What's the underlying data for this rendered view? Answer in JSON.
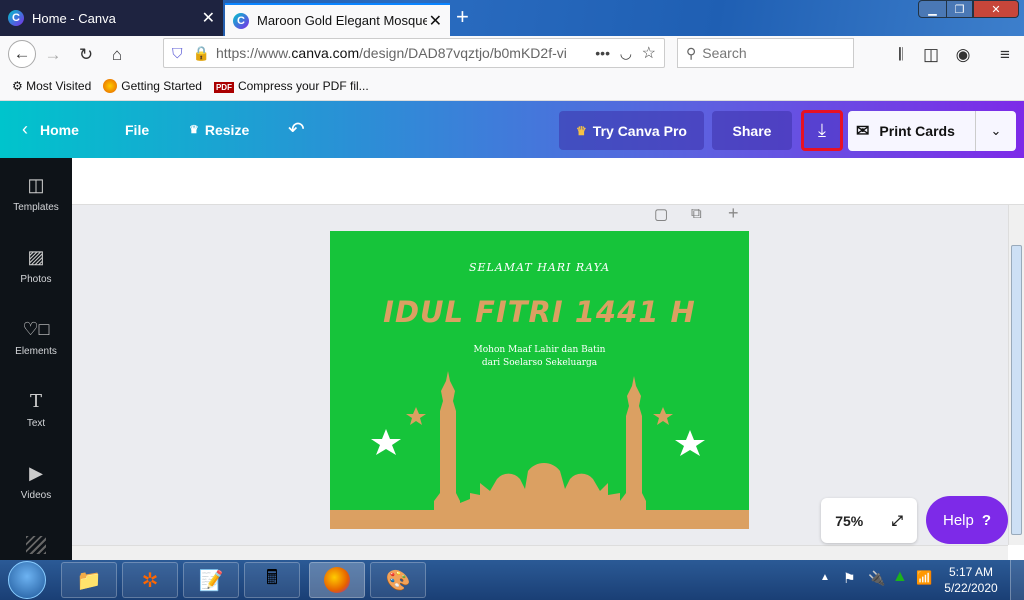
{
  "browser": {
    "tabs": [
      {
        "title": "Home - Canva",
        "active": false
      },
      {
        "title": "Maroon Gold Elegant Mosque S",
        "active": true
      }
    ],
    "url_prefix": "https://www.",
    "url_domain": "canva.com",
    "url_path": "/design/DAD87vqztjo/b0mKD2f-vi",
    "search_placeholder": "Search",
    "bookmarks": [
      "Most Visited",
      "Getting Started",
      "Compress your PDF fil..."
    ],
    "pdf_badge": "PDF"
  },
  "canva": {
    "home": "Home",
    "file": "File",
    "resize": "Resize",
    "try_pro": "Try Canva Pro",
    "share": "Share",
    "print": "Print Cards",
    "sidebar": [
      "Templates",
      "Photos",
      "Elements",
      "Text",
      "Videos"
    ],
    "zoom": "75%",
    "help": "Help",
    "help_icon": "?"
  },
  "card": {
    "line1": "SELAMAT HARI RAYA",
    "title": "IDUL FITRI 1441 H",
    "line2": "Mohon Maaf Lahir dan Batin",
    "line3": "dari Soelarso Sekeluarga",
    "colors": {
      "background": "#16c43a",
      "gold": "#dba062",
      "white": "#ffffff"
    }
  },
  "taskbar": {
    "time": "5:17 AM",
    "date": "5/22/2020"
  },
  "accent": {
    "download_highlight": "#e81123",
    "canva_purple": "#7d2ae8",
    "canva_teal": "#00c4cc"
  }
}
